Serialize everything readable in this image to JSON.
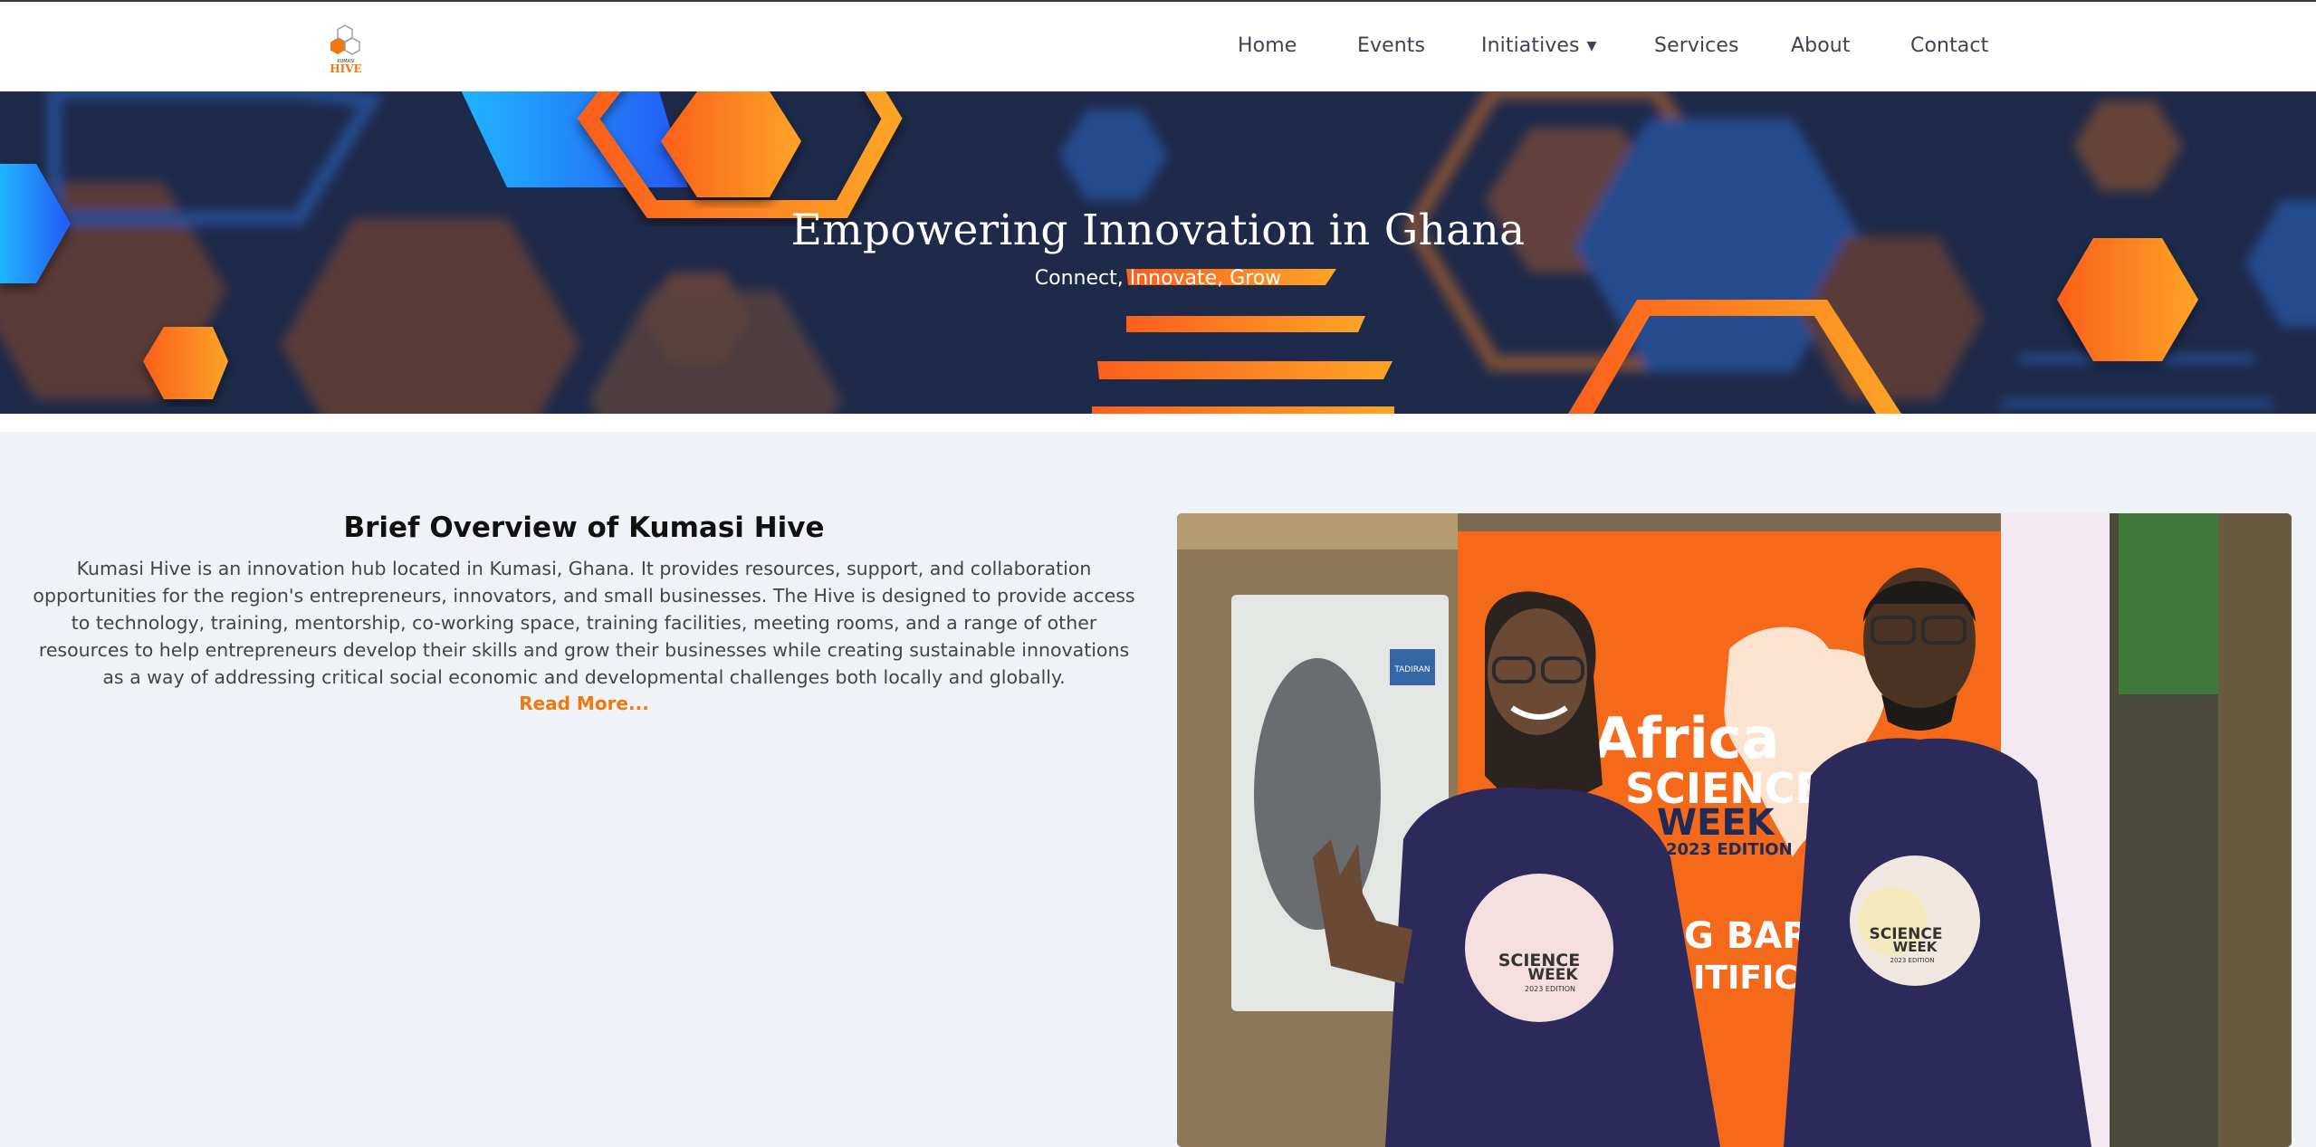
{
  "nav": {
    "logo_text": "HIVE",
    "logo_small": "KUMASI",
    "links": [
      {
        "label": "Home"
      },
      {
        "label": "Events"
      },
      {
        "label": "Initiatives",
        "has_dropdown": true
      },
      {
        "label": "Services"
      },
      {
        "label": "About"
      },
      {
        "label": "Contact"
      }
    ]
  },
  "hero": {
    "title": "Empowering Innovation in Ghana",
    "subtitle": "Connect, Innovate, Grow"
  },
  "overview": {
    "heading": "Brief Overview of Kumasi Hive",
    "text": "Kumasi Hive is an innovation hub located in Kumasi, Ghana. It provides resources, support, and collaboration opportunities for the region's entrepreneurs, innovators, and small businesses. The Hive is designed to provide access to technology, training, mentorship, co-working space, training facilities, meeting rooms, and a range of other resources to help entrepreneurs develop their skills and grow their businesses while creating sustainable innovations as a way of addressing critical social economic and developmental challenges both locally and globally.",
    "read_more": "Read More..."
  },
  "photo": {
    "banner_line1": "Africa",
    "banner_line2": "SCIENCE",
    "banner_line3": "WEEK",
    "banner_line4": "2023 EDITION",
    "banner_line5": "G BARR",
    "banner_line6": "ITIFIC E",
    "shirt_line1": "SCIENCE",
    "shirt_line2": "WEEK",
    "shirt_line3": "2023 EDITION",
    "ac_label": "TADIRAN"
  },
  "colors": {
    "accent": "#f0780f",
    "hero_bg": "#1e2a4a",
    "page_bg": "#eff2f7",
    "navy_shirt": "#2b2a5a"
  }
}
